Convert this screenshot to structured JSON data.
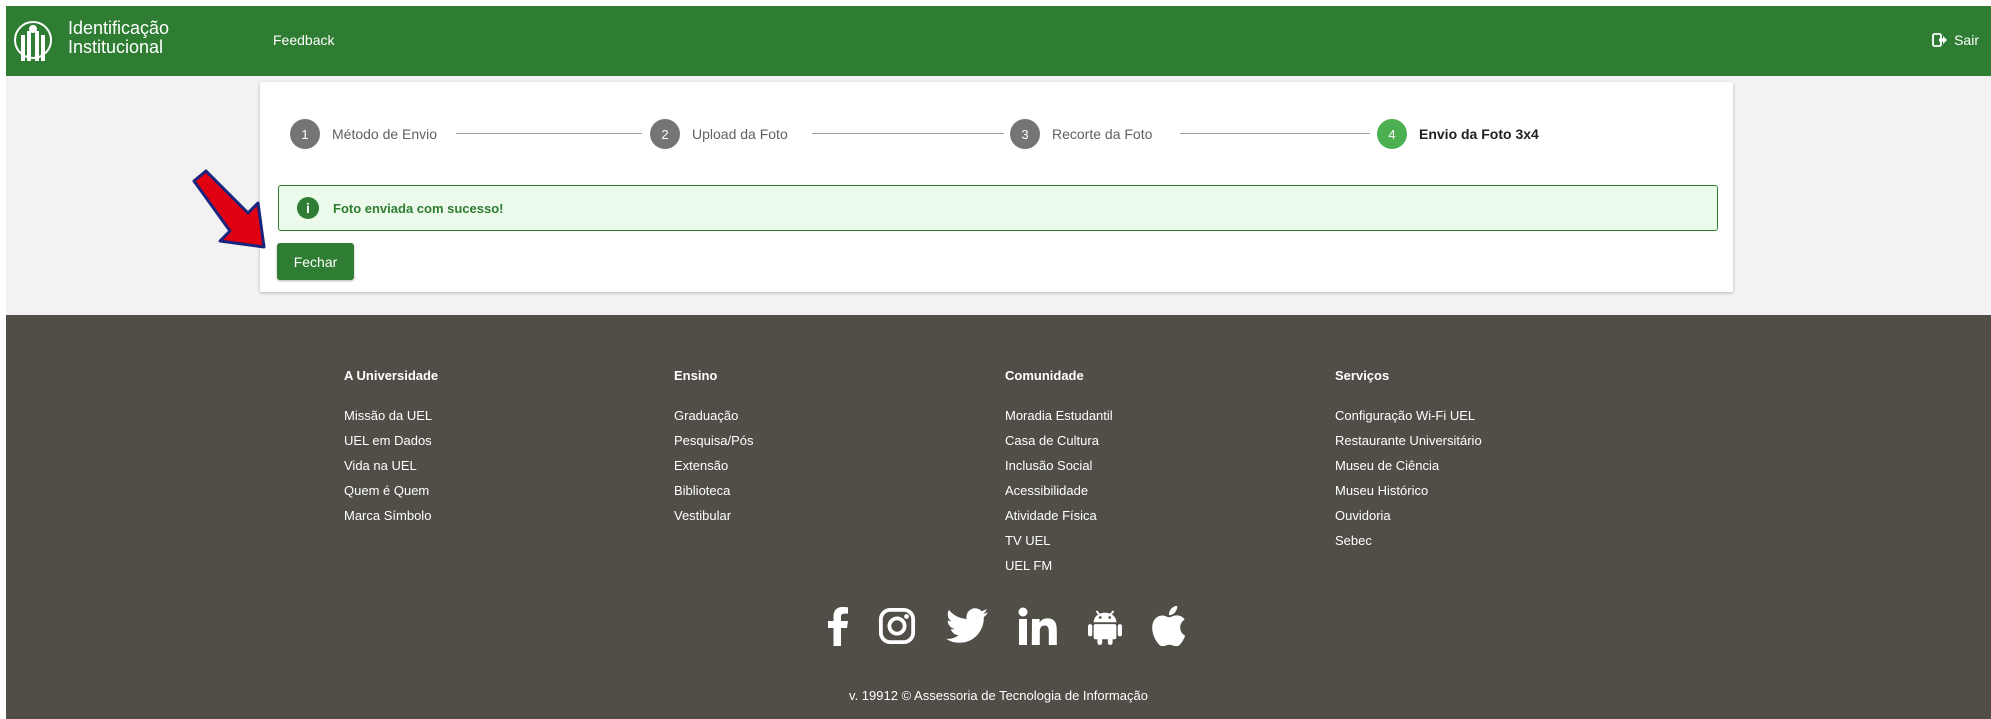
{
  "header": {
    "brand_line1": "Identificação",
    "brand_line2": "Institucional",
    "nav_feedback": "Feedback",
    "logout_label": "Sair",
    "color": "#2e7d32"
  },
  "stepper": {
    "steps": [
      {
        "number": "1",
        "label": "Método de Envio",
        "state": "done"
      },
      {
        "number": "2",
        "label": "Upload da Foto",
        "state": "done"
      },
      {
        "number": "3",
        "label": "Recorte da Foto",
        "state": "done"
      },
      {
        "number": "4",
        "label": "Envio da Foto 3x4",
        "state": "active"
      }
    ]
  },
  "alert": {
    "icon": "info-icon",
    "message": "Foto enviada com sucesso!"
  },
  "actions": {
    "close_label": "Fechar"
  },
  "footer": {
    "columns": [
      {
        "title": "A Universidade",
        "items": [
          "Missão da UEL",
          "UEL em Dados",
          "Vida na UEL",
          "Quem é Quem",
          "Marca Símbolo"
        ]
      },
      {
        "title": "Ensino",
        "items": [
          "Graduação",
          "Pesquisa/Pós",
          "Extensão",
          "Biblioteca",
          "Vestibular"
        ]
      },
      {
        "title": "Comunidade",
        "items": [
          "Moradia Estudantil",
          "Casa de Cultura",
          "Inclusão Social",
          "Acessibilidade",
          "Atividade Física",
          "TV UEL",
          "UEL FM"
        ]
      },
      {
        "title": "Serviços",
        "items": [
          "Configuração Wi-Fi UEL",
          "Restaurante Universitário",
          "Museu de Ciência",
          "Museu Histórico",
          "Ouvidoria",
          "Sebec"
        ]
      }
    ],
    "social": [
      "facebook-icon",
      "instagram-icon",
      "twitter-icon",
      "linkedin-icon",
      "android-icon",
      "apple-icon"
    ],
    "version": "v. 19912 © Assessoria de Tecnologia de Informação",
    "background": "#504e47"
  }
}
